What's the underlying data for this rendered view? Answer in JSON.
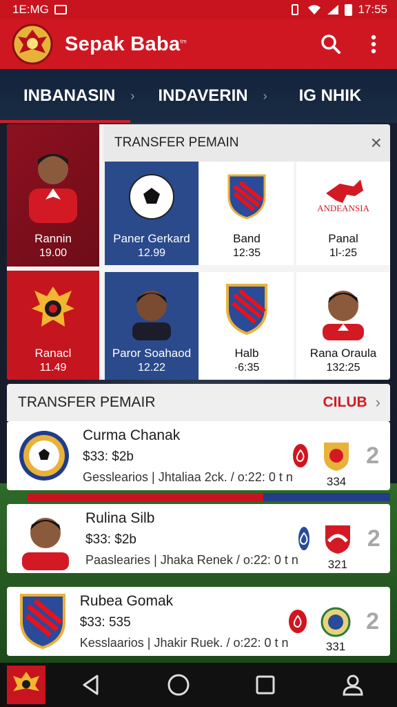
{
  "status_bar": {
    "left_text": "1E:MG",
    "time": "17:55"
  },
  "app": {
    "title": "Sepak Baba",
    "title_mark": "tm"
  },
  "tabs": [
    {
      "label": "INBANASIN",
      "active": true
    },
    {
      "label": "INDAVERIN",
      "active": false
    },
    {
      "label": "IG NHIK",
      "active": false
    }
  ],
  "transfer_grid": {
    "title": "TRANSFER PEMAIN",
    "lead_tiles": [
      {
        "name": "Rannin",
        "value": "19.00"
      },
      {
        "name": "Ranacl",
        "value": "11.49"
      }
    ],
    "cells": [
      {
        "name": "Paner Gerkard",
        "value": "12.99",
        "style": "blue",
        "icon": "soccer-ball-icon"
      },
      {
        "name": "Band",
        "value": "12:35",
        "style": "white",
        "icon": "club-crest-icon"
      },
      {
        "name": "Panal",
        "value": "1l-:25",
        "style": "white",
        "icon": "club-logo-icon",
        "logo_text": "ANDEANSIA"
      },
      {
        "name": "Paror Soahaod",
        "value": "12.22",
        "style": "blue",
        "icon": "player-photo-icon"
      },
      {
        "name": "Halb",
        "value": "·6:35",
        "style": "white",
        "icon": "club-crest-icon"
      },
      {
        "name": "Rana Oraula",
        "value": "132:25",
        "style": "white",
        "icon": "player-photo-icon"
      }
    ]
  },
  "transfer_list": {
    "title": "TRANSFER PEMAIR",
    "club_label": "CILUB",
    "rows": [
      {
        "name": "Curma Chanak",
        "price": "$33: $2b",
        "meta_left": "Gesslearios",
        "meta_right": "Jhtaliaa 2ck. / o:22: 0 t n",
        "number": "334",
        "badge_color": "#d3141e",
        "rank": "2"
      },
      {
        "name": "Rulina Silb",
        "price": "$33: $2b",
        "meta_left": "Paaslearies",
        "meta_right": "Jhaka Renek / o:22: 0 t n",
        "number": "321",
        "badge_color": "#2a4a9a",
        "rank": "2"
      },
      {
        "name": "Rubea Gomak",
        "price": "$33: 535",
        "meta_left": "Kesslaarios",
        "meta_right": "Jhakir Ruek. / o:22: 0 t n",
        "number": "331",
        "badge_color": "#d3141e",
        "rank": "2"
      }
    ]
  },
  "colors": {
    "primary_red": "#cf1722",
    "navy": "#12233b",
    "blue_tile": "#2a4a8c"
  }
}
